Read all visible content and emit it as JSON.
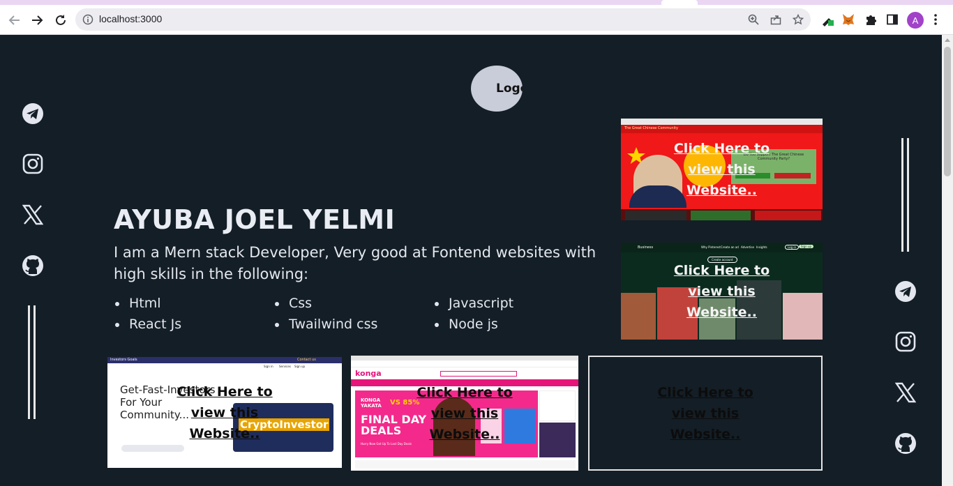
{
  "browser": {
    "url": "localhost:3000",
    "avatar_letter": "A"
  },
  "hero": {
    "logo_text": "Logo",
    "name": "AYUBA JOEL YELMI",
    "intro": "I am a Mern stack Developer, Very good at Fontend websites with high skills in the following:",
    "skills": [
      "Html",
      "Css",
      "Javascript",
      "React Js",
      "Twailwind css",
      "Node js"
    ]
  },
  "cards": {
    "cta": "Click Here to view this Website..",
    "investors": {
      "brand": "Investors Goals",
      "headline": "Get-Fast-Investors For Your Community...",
      "badge": "CryptoInvestor",
      "nav": [
        "Sign in",
        "Services",
        "Sign up"
      ],
      "contact": "Contact us"
    },
    "konga": {
      "brand": "konga",
      "promo_top": "KONGA YAKATA",
      "promo_pct": "VS 85%",
      "promo_main": "FINAL DAY DEALS",
      "promo_sub": "Hurry Now Get Up To Last Day Deals"
    },
    "china": {
      "banner": "The Great Chinese Community",
      "question": "Do You Support The Great Chinese Community Party?"
    },
    "business": {
      "brand": "Business",
      "nav": [
        "Why Pinterest",
        "Create an ad",
        "Advertise",
        "Insights",
        "Log in",
        "Sign up"
      ],
      "button": "Create account"
    }
  },
  "colors": {
    "page_bg": "#141e26",
    "text": "#e4e7ee",
    "logo_bg": "#c9ccd9",
    "china_red": "#f01818",
    "konga_pink": "#e6157a"
  }
}
